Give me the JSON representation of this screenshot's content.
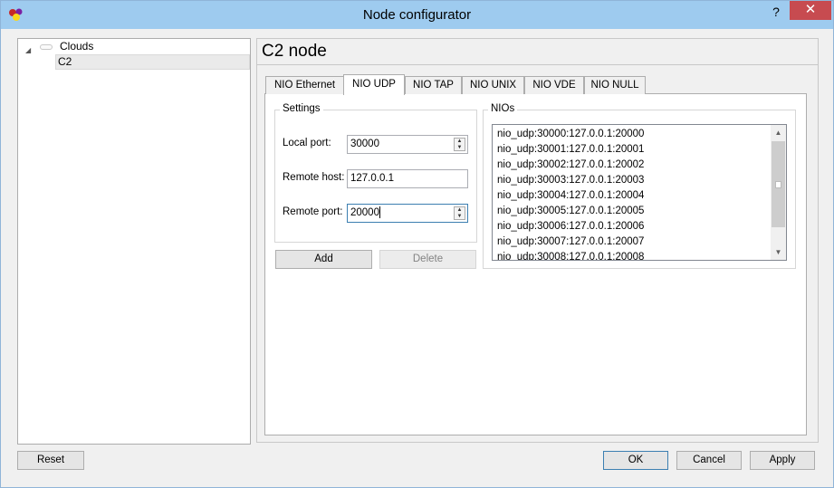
{
  "window": {
    "title": "Node configurator",
    "help_label": "?",
    "close_label": "✕"
  },
  "tree": {
    "items": [
      {
        "label": "Clouds",
        "icon": "cloud-icon"
      },
      {
        "label": "C2"
      }
    ]
  },
  "node": {
    "title": "C2 node"
  },
  "tabs": [
    {
      "label": "NIO Ethernet"
    },
    {
      "label": "NIO UDP",
      "active": true
    },
    {
      "label": "NIO TAP"
    },
    {
      "label": "NIO UNIX"
    },
    {
      "label": "NIO VDE"
    },
    {
      "label": "NIO NULL"
    }
  ],
  "settings": {
    "group_label": "Settings",
    "local_port_label": "Local port:",
    "local_port_value": "30000",
    "remote_host_label": "Remote host:",
    "remote_host_value": "127.0.0.1",
    "remote_port_label": "Remote port:",
    "remote_port_value": "20000",
    "add_label": "Add",
    "delete_label": "Delete"
  },
  "nios": {
    "group_label": "NIOs",
    "items": [
      "nio_udp:30000:127.0.0.1:20000",
      "nio_udp:30001:127.0.0.1:20001",
      "nio_udp:30002:127.0.0.1:20002",
      "nio_udp:30003:127.0.0.1:20003",
      "nio_udp:30004:127.0.0.1:20004",
      "nio_udp:30005:127.0.0.1:20005",
      "nio_udp:30006:127.0.0.1:20006",
      "nio_udp:30007:127.0.0.1:20007",
      "nio_udp:30008:127.0.0.1:20008"
    ]
  },
  "footer": {
    "reset_label": "Reset",
    "ok_label": "OK",
    "cancel_label": "Cancel",
    "apply_label": "Apply"
  },
  "colors": {
    "titlebar": "#9ecbef",
    "close": "#c74b50",
    "tab_active": "#ffffff"
  }
}
